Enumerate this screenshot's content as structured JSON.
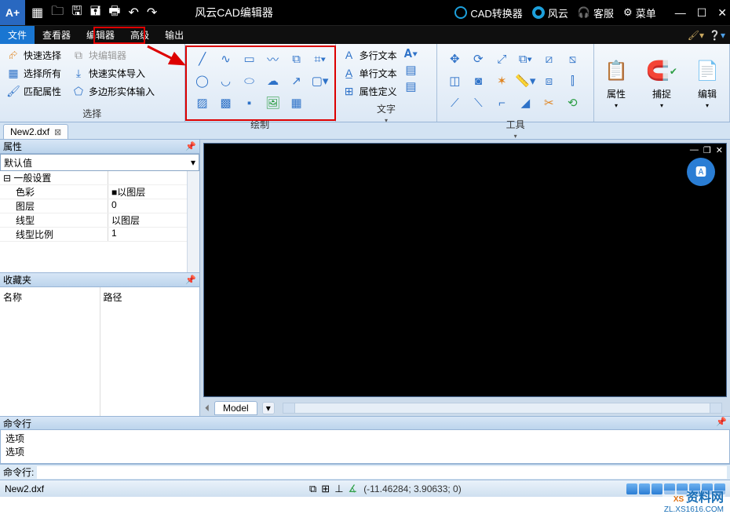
{
  "app": {
    "title": "风云CAD编辑器",
    "logo_text": "A+"
  },
  "titlebar_right": {
    "converter": "CAD转换器",
    "fengyun": "风云",
    "support": "客服",
    "menu": "菜单"
  },
  "menu": {
    "file": "文件",
    "viewer": "查看器",
    "editor": "编辑器",
    "advanced": "高级",
    "output": "输出"
  },
  "ribbon": {
    "select_panel": {
      "label": "选择",
      "quick_select": "快速选择",
      "select_all": "选择所有",
      "match_props": "匹配属性",
      "block_editor": "块编辑器",
      "quick_entity_import": "快速实体导入",
      "polygon_entity_input": "多边形实体输入"
    },
    "draw_panel": {
      "label": "绘制"
    },
    "text_panel": {
      "label": "文字",
      "mtext": "多行文本",
      "stext": "单行文本",
      "attdef": "属性定义"
    },
    "tools_panel": {
      "label": "工具"
    },
    "props_btn": "属性",
    "snap_btn": "捕捉",
    "edit_btn": "编辑"
  },
  "doc_tab": "New2.dxf",
  "panels": {
    "properties_title": "属性",
    "default_value": "默认值",
    "group_general": "一般设置",
    "rows": {
      "color_k": "色彩",
      "color_v": "以图层",
      "layer_k": "图层",
      "layer_v": "0",
      "linetype_k": "线型",
      "linetype_v": "以图层",
      "ltscale_k": "线型比例",
      "ltscale_v": "1"
    },
    "favorites_title": "收藏夹",
    "fav_name": "名称",
    "fav_path": "路径"
  },
  "canvas": {
    "model_tab": "Model"
  },
  "command": {
    "title": "命令行",
    "log1": "选项",
    "log2": "选项",
    "prompt": "命令行:"
  },
  "status": {
    "filename": "New2.dxf",
    "coords": "(-11.46284; 3.90633; 0)"
  },
  "watermark": {
    "brand_prefix": "XS",
    "brand": "资料网",
    "url": "ZL.XS1616.COM"
  }
}
